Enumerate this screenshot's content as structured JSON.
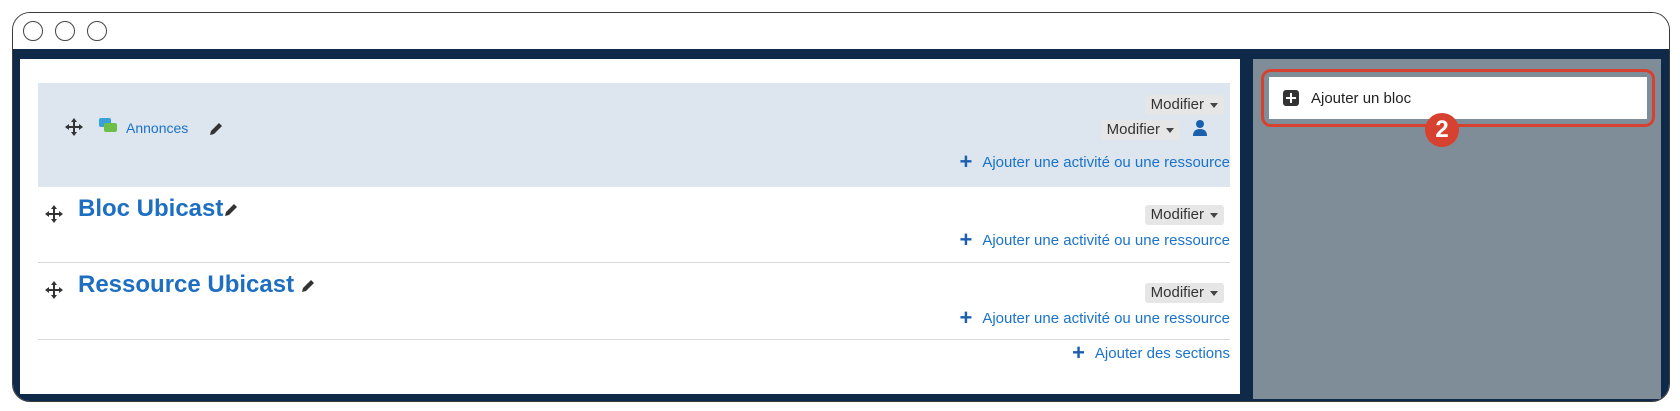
{
  "window": {
    "controls": [
      "close",
      "minimize",
      "zoom"
    ]
  },
  "sections": [
    {
      "type": "activity",
      "icon": "forum-icon",
      "title": "Annonces",
      "modifier_1": "Modifier",
      "modifier_2": "Modifier",
      "add_label": "Ajouter une activité ou une ressource"
    },
    {
      "type": "section",
      "title": "Bloc Ubicast",
      "modifier": "Modifier",
      "add_label": "Ajouter une activité ou une ressource"
    },
    {
      "type": "section",
      "title": "Ressource Ubicast",
      "modifier": "Modifier",
      "add_label": "Ajouter une activité ou une ressource"
    }
  ],
  "add_sections_label": "Ajouter des sections",
  "sidebar": {
    "add_block_label": "Ajouter un bloc",
    "callout_number": "2"
  },
  "colors": {
    "frame": "#0f2a48",
    "sidebar": "#7f8d99",
    "highlight": "#d7412f",
    "link": "#1a73c9"
  }
}
